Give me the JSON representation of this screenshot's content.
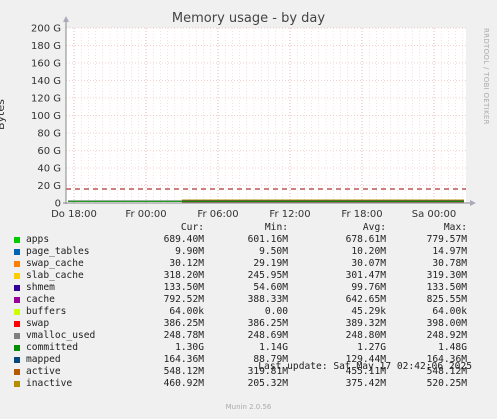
{
  "chart_data": {
    "type": "area",
    "title": "Memory usage - by day",
    "ylabel": "Bytes",
    "ylim": [
      0,
      200
    ],
    "y_ticks": [
      "0",
      "20 G",
      "40 G",
      "60 G",
      "80 G",
      "100 G",
      "120 G",
      "140 G",
      "160 G",
      "180 G",
      "200 G"
    ],
    "x_ticks": [
      "Do 18:00",
      "Fr 00:00",
      "Fr 06:00",
      "Fr 12:00",
      "Fr 18:00",
      "Sa 00:00"
    ],
    "grid": true,
    "dashed_limit_gb": 16,
    "series": [
      {
        "name": "apps",
        "color": "#00cc00",
        "cur": "689.40M",
        "min": "601.16M",
        "avg": "678.61M",
        "max": "779.57M"
      },
      {
        "name": "page_tables",
        "color": "#0066b3",
        "cur": "9.90M",
        "min": "9.50M",
        "avg": "10.20M",
        "max": "14.97M"
      },
      {
        "name": "swap_cache",
        "color": "#ff8000",
        "cur": "30.12M",
        "min": "29.19M",
        "avg": "30.07M",
        "max": "30.78M"
      },
      {
        "name": "slab_cache",
        "color": "#ffcc00",
        "cur": "318.20M",
        "min": "245.95M",
        "avg": "301.47M",
        "max": "319.30M"
      },
      {
        "name": "shmem",
        "color": "#330099",
        "cur": "133.50M",
        "min": "54.60M",
        "avg": "99.76M",
        "max": "133.50M"
      },
      {
        "name": "cache",
        "color": "#990099",
        "cur": "792.52M",
        "min": "388.33M",
        "avg": "642.65M",
        "max": "825.55M"
      },
      {
        "name": "buffers",
        "color": "#ccff00",
        "cur": "64.00k",
        "min": "0.00",
        "avg": "45.29k",
        "max": "64.00k"
      },
      {
        "name": "swap",
        "color": "#ff0000",
        "cur": "386.25M",
        "min": "386.25M",
        "avg": "389.32M",
        "max": "398.00M"
      },
      {
        "name": "vmalloc_used",
        "color": "#808080",
        "cur": "248.78M",
        "min": "248.69M",
        "avg": "248.80M",
        "max": "248.92M"
      },
      {
        "name": "committed",
        "color": "#008f00",
        "cur": "1.30G",
        "min": "1.14G",
        "avg": "1.27G",
        "max": "1.48G"
      },
      {
        "name": "mapped",
        "color": "#00487d",
        "cur": "164.36M",
        "min": "88.79M",
        "avg": "129.44M",
        "max": "164.36M"
      },
      {
        "name": "active",
        "color": "#b35a00",
        "cur": "548.12M",
        "min": "319.81M",
        "avg": "455.11M",
        "max": "548.12M"
      },
      {
        "name": "inactive",
        "color": "#b38f00",
        "cur": "460.92M",
        "min": "205.32M",
        "avg": "375.42M",
        "max": "520.25M"
      }
    ]
  },
  "legend_headers": {
    "cur": "Cur:",
    "min": "Min:",
    "avg": "Avg:",
    "max": "Max:"
  },
  "side_text": "RRDTOOL / TOBI OETIKER",
  "last_update": "Last update: Sat May 17 02:42:06 2025",
  "version": "Munin 2.0.56"
}
